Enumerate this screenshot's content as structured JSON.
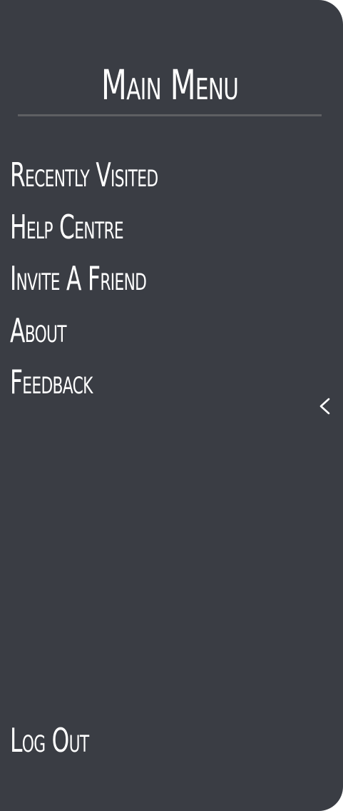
{
  "menu": {
    "title": "Main Menu",
    "items": [
      {
        "label": "Recently Visited"
      },
      {
        "label": "Help Centre"
      },
      {
        "label": "Invite A Friend"
      },
      {
        "label": "About"
      },
      {
        "label": "Feedback"
      }
    ],
    "logout_label": "Log Out"
  },
  "colors": {
    "background": "#3a3d44",
    "text": "#ffffff",
    "divider": "#5e5f63"
  },
  "icons": {
    "collapse": "chevron-left-icon"
  }
}
